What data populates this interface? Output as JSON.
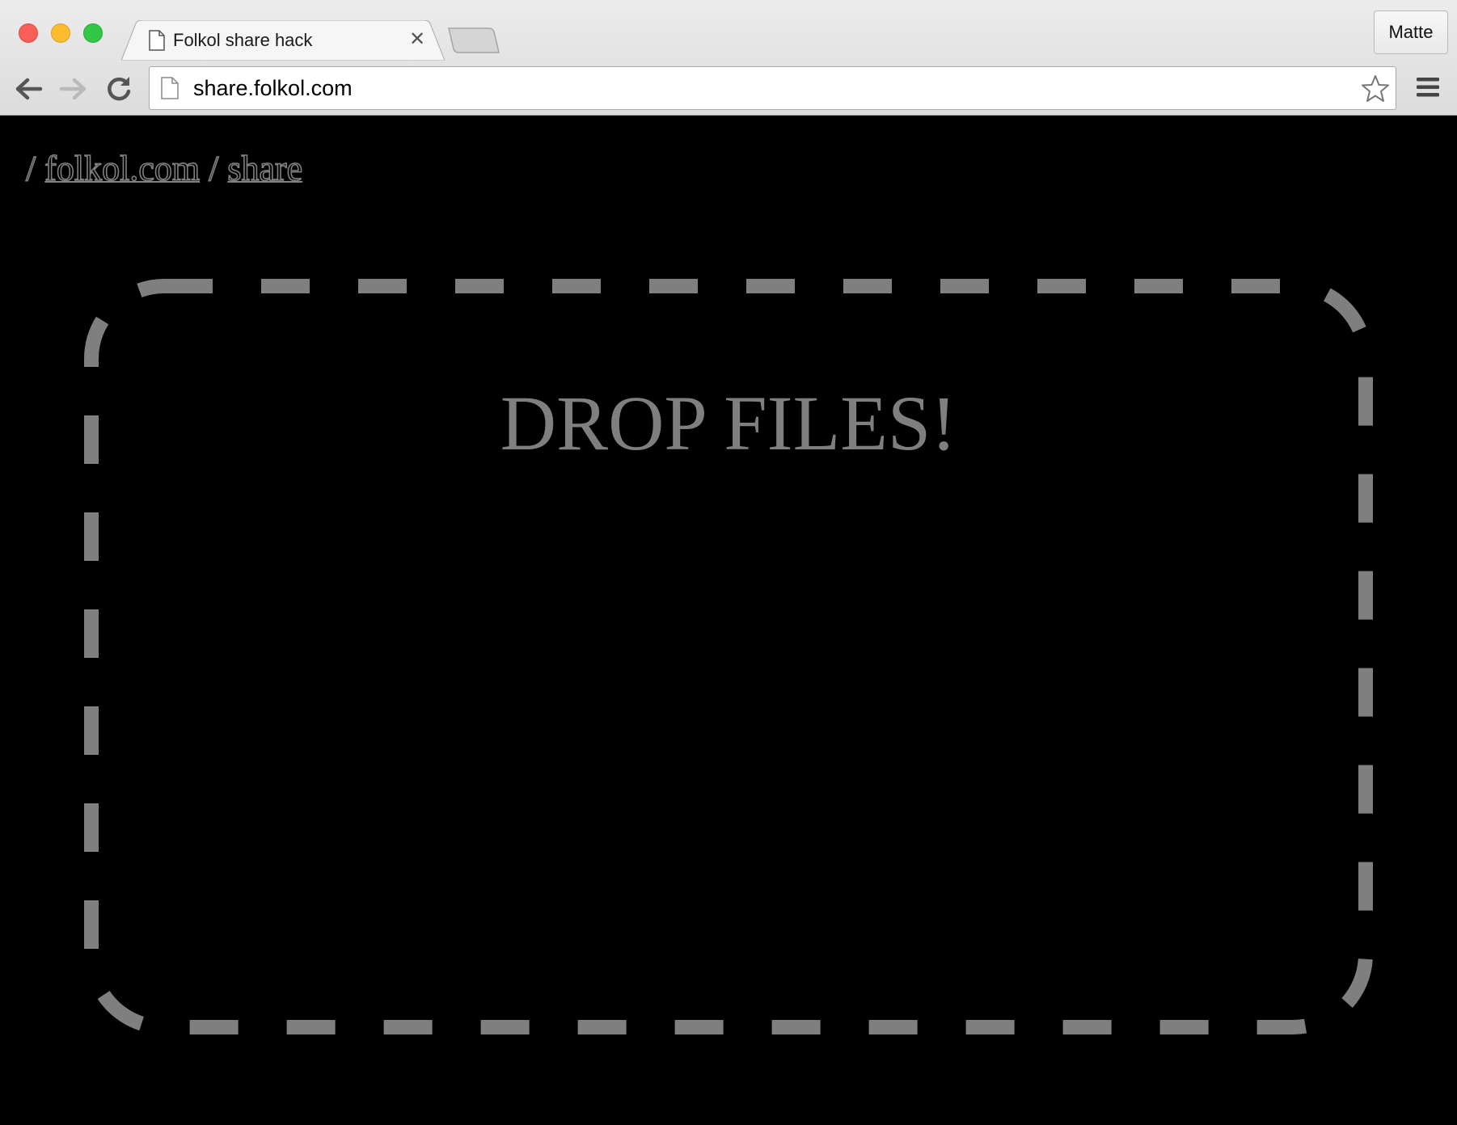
{
  "browser": {
    "tab": {
      "title": "Folkol share hack",
      "close_glyph": "✕",
      "favicon": "page-icon"
    },
    "profile_label": "Matte",
    "address_bar": {
      "url": "share.folkol.com",
      "page_icon": "page-icon"
    },
    "icons": {
      "back": "back-arrow-icon",
      "forward": "forward-arrow-icon",
      "reload": "reload-icon",
      "bookmark": "star-icon",
      "menu": "hamburger-menu-icon"
    }
  },
  "page": {
    "breadcrumb": {
      "separator_1": "/ ",
      "site_link": "folkol.com",
      "separator_2": " / ",
      "section_link": "share"
    },
    "dropzone": {
      "title": "DROP FILES!"
    },
    "colors": {
      "background": "#000000",
      "foreground": "#7f7f7f"
    }
  }
}
